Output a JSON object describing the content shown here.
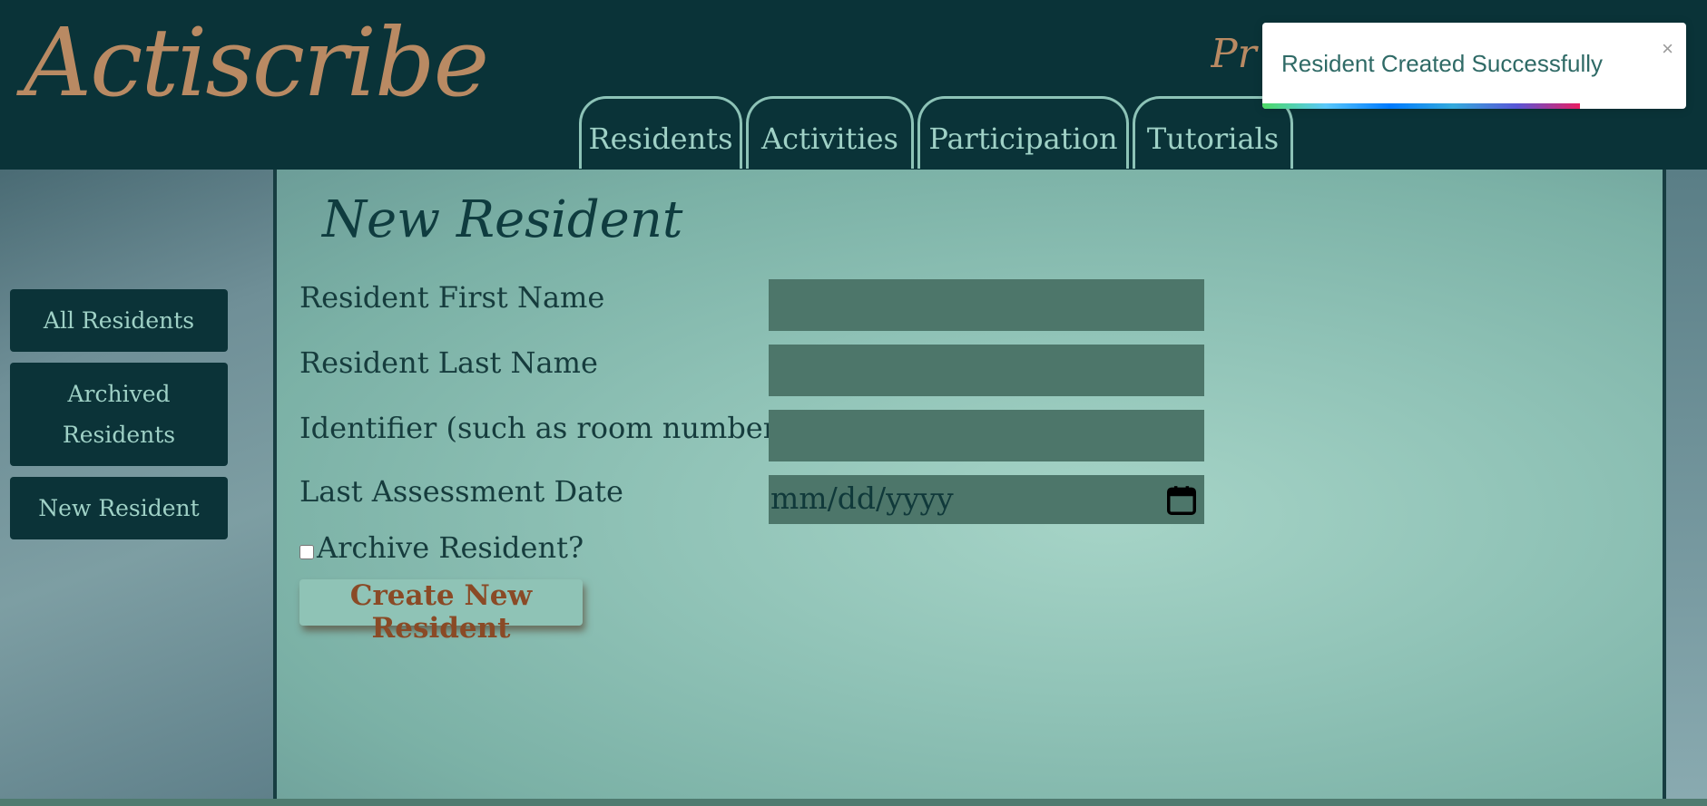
{
  "header": {
    "logo": "Actiscribe",
    "tagline": "Pr",
    "tabs": [
      {
        "label": "Residents"
      },
      {
        "label": "Activities"
      },
      {
        "label": "Participation"
      },
      {
        "label": "Tutorials"
      }
    ]
  },
  "sidebar": {
    "items": [
      {
        "label": "All Residents"
      },
      {
        "label": "Archived Residents"
      },
      {
        "label": "New Resident"
      }
    ]
  },
  "form": {
    "title": "New Resident",
    "first_name_label": "Resident First Name",
    "last_name_label": "Resident Last Name",
    "identifier_label": "Identifier (such as room number)",
    "assessment_label": "Last Assessment Date",
    "date_placeholder": "mm/dd/yyyy",
    "archive_label": "Archive Resident?",
    "archive_checked": false,
    "submit_label": "Create New Resident"
  },
  "toast": {
    "message": "Resident Created Successfully",
    "close_symbol": "×",
    "progress": 0.75
  },
  "colors": {
    "header_bg": "#0a3338",
    "accent_copper": "#b98a63",
    "tab_text": "#9fd1c6",
    "field_bg": "#4d766a",
    "button_text": "#8a4a26"
  }
}
